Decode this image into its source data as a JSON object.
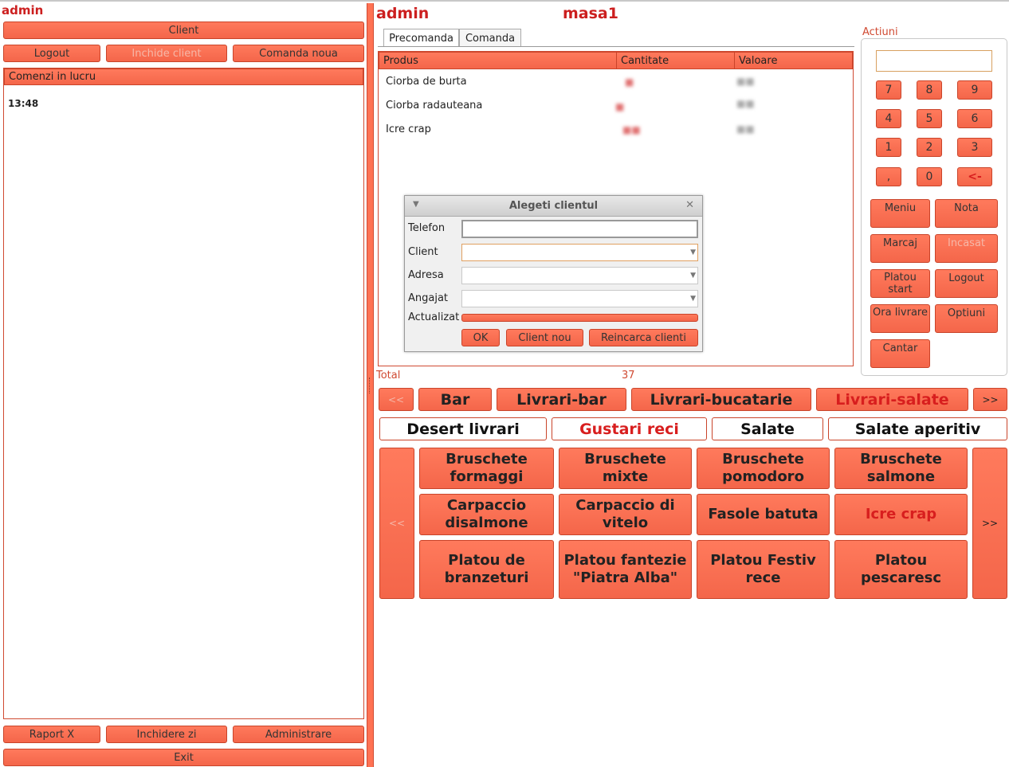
{
  "left": {
    "user": "admin",
    "client_button": "Client",
    "logout_button": "Logout",
    "inchide_client_button": "Inchide client",
    "comanda_noua_button": "Comanda noua",
    "comenzi_header": "Comenzi in lucru",
    "order_time": "13:48",
    "raport_x_button": "Raport X",
    "inchidere_zi_button": "Inchidere zi",
    "administrare_button": "Administrare",
    "exit_button": "Exit"
  },
  "header": {
    "user": "admin",
    "table": "masa1"
  },
  "tabs": [
    {
      "label": "Precomanda",
      "active": true
    },
    {
      "label": "Comanda",
      "active": false
    }
  ],
  "order_table": {
    "columns": [
      "Produs",
      "Cantitate",
      "Valoare"
    ],
    "rows": [
      {
        "product": "Ciorba de burta"
      },
      {
        "product": "Ciorba radauteana"
      },
      {
        "product": "Icre crap"
      }
    ]
  },
  "total": {
    "label": "Total",
    "value": "37"
  },
  "dialog": {
    "title": "Alegeti clientul",
    "fields": {
      "telefon": "Telefon",
      "client": "Client",
      "adresa": "Adresa",
      "angajat": "Angajat",
      "actualizat": "Actualizat"
    },
    "ok_button": "OK",
    "client_nou_button": "Client nou",
    "reincarca_button": "Reincarca clienti"
  },
  "actions": {
    "title": "Actiuni",
    "keys": [
      "7",
      "8",
      "9",
      "4",
      "5",
      "6",
      "1",
      "2",
      "3",
      ",",
      "0",
      "<-"
    ],
    "meniu": "Meniu",
    "nota": "Nota",
    "marcaj": "Marcaj",
    "incasat": "Incasat",
    "platou_start": "Platou start",
    "logout": "Logout",
    "ora_livrare": "Ora livrare",
    "optiuni": "Optiuni",
    "cantar": "Cantar"
  },
  "categories": {
    "prev": "<<",
    "next": ">>",
    "items": [
      {
        "label": "Bar",
        "selected": false
      },
      {
        "label": "Livrari-bar",
        "selected": false
      },
      {
        "label": "Livrari-bucatarie",
        "selected": false
      },
      {
        "label": "Livrari-salate",
        "selected": true
      }
    ]
  },
  "subcategories": [
    {
      "label": "Desert livrari",
      "selected": false
    },
    {
      "label": "Gustari reci",
      "selected": true
    },
    {
      "label": "Salate",
      "selected": false
    },
    {
      "label": "Salate aperitiv",
      "selected": false
    }
  ],
  "products": {
    "prev": "<<",
    "next": ">>",
    "items": [
      {
        "label": "Bruschete formaggi",
        "selected": false
      },
      {
        "label": "Bruschete mixte",
        "selected": false
      },
      {
        "label": "Bruschete pomodoro",
        "selected": false
      },
      {
        "label": "Bruschete salmone",
        "selected": false
      },
      {
        "label": "Carpaccio disalmone",
        "selected": false
      },
      {
        "label": "Carpaccio di vitelo",
        "selected": false
      },
      {
        "label": "Fasole batuta",
        "selected": false
      },
      {
        "label": "Icre crap",
        "selected": true
      },
      {
        "label": "Platou de branzeturi",
        "selected": false
      },
      {
        "label": "Platou fantezie \"Piatra Alba\"",
        "selected": false
      },
      {
        "label": "Platou Festiv rece",
        "selected": false
      },
      {
        "label": "Platou pescaresc",
        "selected": false
      }
    ]
  }
}
